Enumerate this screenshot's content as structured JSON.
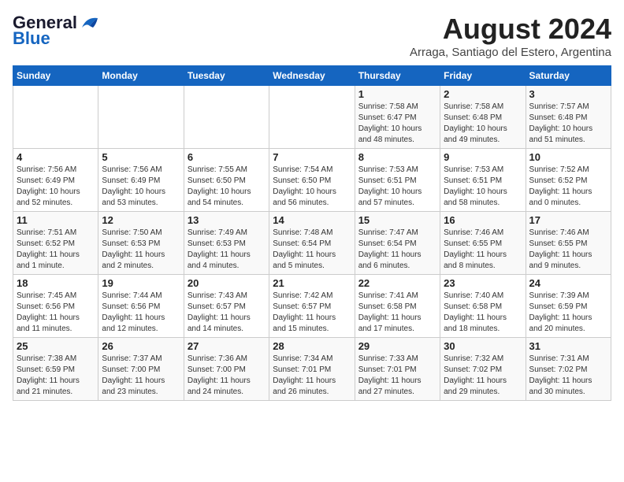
{
  "logo": {
    "general": "General",
    "blue": "Blue"
  },
  "title": "August 2024",
  "subtitle": "Arraga, Santiago del Estero, Argentina",
  "days_of_week": [
    "Sunday",
    "Monday",
    "Tuesday",
    "Wednesday",
    "Thursday",
    "Friday",
    "Saturday"
  ],
  "weeks": [
    [
      {
        "day": "",
        "info": ""
      },
      {
        "day": "",
        "info": ""
      },
      {
        "day": "",
        "info": ""
      },
      {
        "day": "",
        "info": ""
      },
      {
        "day": "1",
        "info": "Sunrise: 7:58 AM\nSunset: 6:47 PM\nDaylight: 10 hours\nand 48 minutes."
      },
      {
        "day": "2",
        "info": "Sunrise: 7:58 AM\nSunset: 6:48 PM\nDaylight: 10 hours\nand 49 minutes."
      },
      {
        "day": "3",
        "info": "Sunrise: 7:57 AM\nSunset: 6:48 PM\nDaylight: 10 hours\nand 51 minutes."
      }
    ],
    [
      {
        "day": "4",
        "info": "Sunrise: 7:56 AM\nSunset: 6:49 PM\nDaylight: 10 hours\nand 52 minutes."
      },
      {
        "day": "5",
        "info": "Sunrise: 7:56 AM\nSunset: 6:49 PM\nDaylight: 10 hours\nand 53 minutes."
      },
      {
        "day": "6",
        "info": "Sunrise: 7:55 AM\nSunset: 6:50 PM\nDaylight: 10 hours\nand 54 minutes."
      },
      {
        "day": "7",
        "info": "Sunrise: 7:54 AM\nSunset: 6:50 PM\nDaylight: 10 hours\nand 56 minutes."
      },
      {
        "day": "8",
        "info": "Sunrise: 7:53 AM\nSunset: 6:51 PM\nDaylight: 10 hours\nand 57 minutes."
      },
      {
        "day": "9",
        "info": "Sunrise: 7:53 AM\nSunset: 6:51 PM\nDaylight: 10 hours\nand 58 minutes."
      },
      {
        "day": "10",
        "info": "Sunrise: 7:52 AM\nSunset: 6:52 PM\nDaylight: 11 hours\nand 0 minutes."
      }
    ],
    [
      {
        "day": "11",
        "info": "Sunrise: 7:51 AM\nSunset: 6:52 PM\nDaylight: 11 hours\nand 1 minute."
      },
      {
        "day": "12",
        "info": "Sunrise: 7:50 AM\nSunset: 6:53 PM\nDaylight: 11 hours\nand 2 minutes."
      },
      {
        "day": "13",
        "info": "Sunrise: 7:49 AM\nSunset: 6:53 PM\nDaylight: 11 hours\nand 4 minutes."
      },
      {
        "day": "14",
        "info": "Sunrise: 7:48 AM\nSunset: 6:54 PM\nDaylight: 11 hours\nand 5 minutes."
      },
      {
        "day": "15",
        "info": "Sunrise: 7:47 AM\nSunset: 6:54 PM\nDaylight: 11 hours\nand 6 minutes."
      },
      {
        "day": "16",
        "info": "Sunrise: 7:46 AM\nSunset: 6:55 PM\nDaylight: 11 hours\nand 8 minutes."
      },
      {
        "day": "17",
        "info": "Sunrise: 7:46 AM\nSunset: 6:55 PM\nDaylight: 11 hours\nand 9 minutes."
      }
    ],
    [
      {
        "day": "18",
        "info": "Sunrise: 7:45 AM\nSunset: 6:56 PM\nDaylight: 11 hours\nand 11 minutes."
      },
      {
        "day": "19",
        "info": "Sunrise: 7:44 AM\nSunset: 6:56 PM\nDaylight: 11 hours\nand 12 minutes."
      },
      {
        "day": "20",
        "info": "Sunrise: 7:43 AM\nSunset: 6:57 PM\nDaylight: 11 hours\nand 14 minutes."
      },
      {
        "day": "21",
        "info": "Sunrise: 7:42 AM\nSunset: 6:57 PM\nDaylight: 11 hours\nand 15 minutes."
      },
      {
        "day": "22",
        "info": "Sunrise: 7:41 AM\nSunset: 6:58 PM\nDaylight: 11 hours\nand 17 minutes."
      },
      {
        "day": "23",
        "info": "Sunrise: 7:40 AM\nSunset: 6:58 PM\nDaylight: 11 hours\nand 18 minutes."
      },
      {
        "day": "24",
        "info": "Sunrise: 7:39 AM\nSunset: 6:59 PM\nDaylight: 11 hours\nand 20 minutes."
      }
    ],
    [
      {
        "day": "25",
        "info": "Sunrise: 7:38 AM\nSunset: 6:59 PM\nDaylight: 11 hours\nand 21 minutes."
      },
      {
        "day": "26",
        "info": "Sunrise: 7:37 AM\nSunset: 7:00 PM\nDaylight: 11 hours\nand 23 minutes."
      },
      {
        "day": "27",
        "info": "Sunrise: 7:36 AM\nSunset: 7:00 PM\nDaylight: 11 hours\nand 24 minutes."
      },
      {
        "day": "28",
        "info": "Sunrise: 7:34 AM\nSunset: 7:01 PM\nDaylight: 11 hours\nand 26 minutes."
      },
      {
        "day": "29",
        "info": "Sunrise: 7:33 AM\nSunset: 7:01 PM\nDaylight: 11 hours\nand 27 minutes."
      },
      {
        "day": "30",
        "info": "Sunrise: 7:32 AM\nSunset: 7:02 PM\nDaylight: 11 hours\nand 29 minutes."
      },
      {
        "day": "31",
        "info": "Sunrise: 7:31 AM\nSunset: 7:02 PM\nDaylight: 11 hours\nand 30 minutes."
      }
    ]
  ]
}
